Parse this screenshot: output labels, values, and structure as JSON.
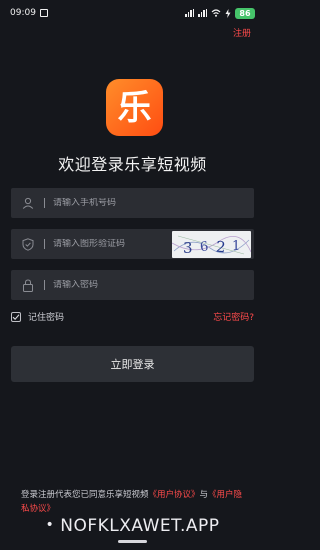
{
  "status_bar": {
    "time": "09:09",
    "battery": "86"
  },
  "header": {
    "register_label": "注册"
  },
  "app": {
    "logo_glyph": "乐",
    "title": "欢迎登录乐享短视频",
    "brand_color": "#ff6a1f"
  },
  "form": {
    "phone_placeholder": "请输入手机号码",
    "captcha_placeholder": "请输入图形验证码",
    "captcha_code": "3621",
    "password_placeholder": "请输入密码",
    "remember_label": "记住密码",
    "remember_checked": true,
    "forgot_label": "忘记密码?",
    "login_label": "立即登录"
  },
  "agreement": {
    "prefix": "登录注册代表您已同意乐享短视频",
    "user_agreement": "《用户协议》",
    "and": "与",
    "privacy_agreement": "《用户隐私协议》"
  },
  "watermark": {
    "dot": "•",
    "text": "NOFKLXAWET.APP"
  },
  "colors": {
    "background": "#15171c",
    "field": "#2b2d33",
    "accent_red": "#ff4b4b",
    "battery_green": "#46c46a"
  }
}
